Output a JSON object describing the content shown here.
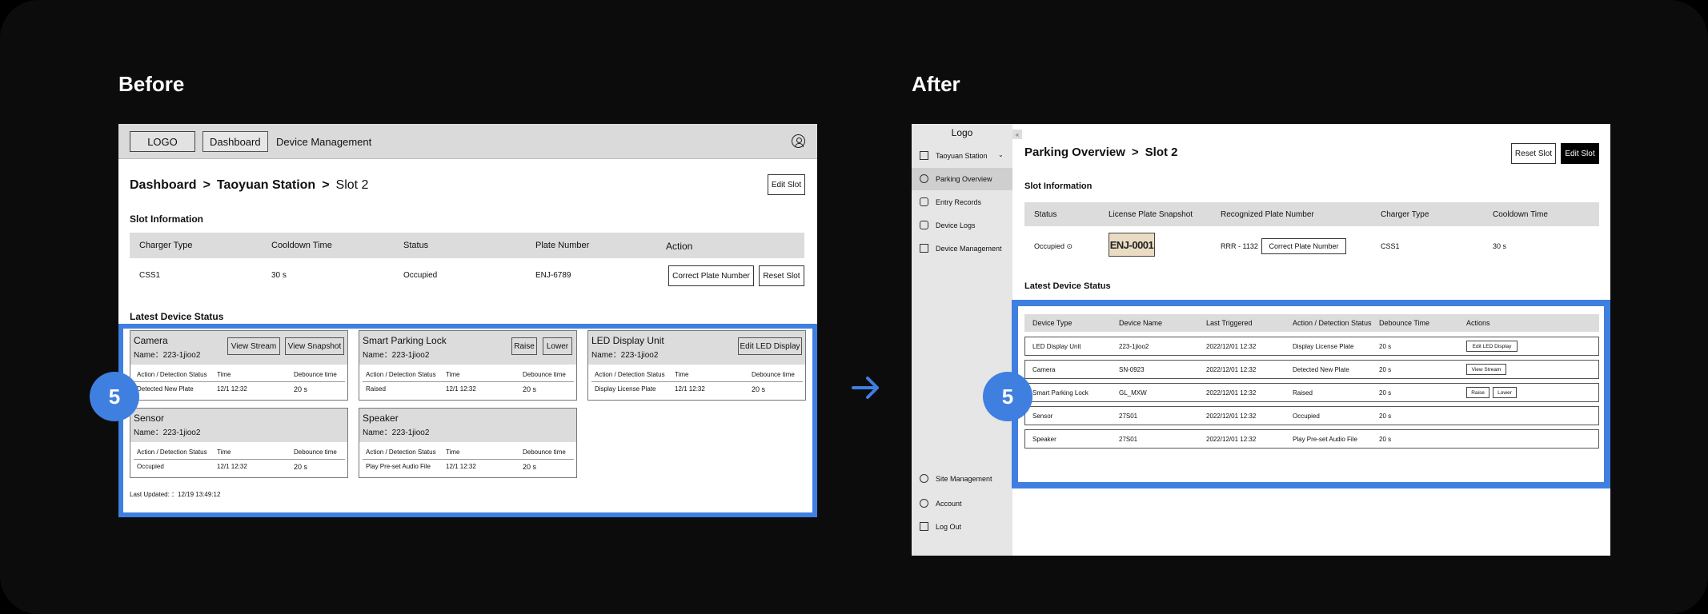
{
  "labels": {
    "before": "Before",
    "after": "After",
    "step_number": "5"
  },
  "colors": {
    "accent": "#3f7fe0",
    "background": "#0c0c0c"
  },
  "before": {
    "topbar": {
      "logo": "LOGO",
      "nav_dashboard": "Dashboard",
      "nav_device_management": "Device Management",
      "user_icon": "user-icon"
    },
    "breadcrumb": {
      "part1": "Dashboard",
      "sep": ">",
      "part2": "Taoyuan Station",
      "part3": "Slot 2"
    },
    "edit_slot": "Edit Slot",
    "slot_info": {
      "title": "Slot Information",
      "headers": [
        "Charger Type",
        "Cooldown Time",
        "Status",
        "Plate Number",
        "Action"
      ],
      "values": [
        "CSS1",
        "30 s",
        "Occupied",
        "ENJ-6789"
      ],
      "correct_plate": "Correct Plate Number",
      "reset_slot": "Reset Slot"
    },
    "latest_title": "Latest Device Status",
    "cards": [
      {
        "title": "Camera",
        "name": "Name：223-1jioo2",
        "buttons": [
          "View Stream",
          "View Snapshot"
        ],
        "col_action": "Action / Detection Status",
        "col_time": "Time",
        "col_debounce": "Debounce time",
        "action": "Detected New Plate",
        "time": "12/1 12:32",
        "debounce": "20 s"
      },
      {
        "title": "Smart Parking Lock",
        "name": "Name：223-1jioo2",
        "buttons": [
          "Raise",
          "Lower"
        ],
        "col_action": "Action / Detection Status",
        "col_time": "Time",
        "col_debounce": "Debounce time",
        "action": "Raised",
        "time": "12/1 12:32",
        "debounce": "20 s"
      },
      {
        "title": "LED Display Unit",
        "name": "Name：223-1jioo2",
        "buttons": [
          "Edit LED Display"
        ],
        "col_action": "Action / Detection Status",
        "col_time": "Time",
        "col_debounce": "Debounce time",
        "action": "Display License Plate",
        "time": "12/1 12:32",
        "debounce": "20 s"
      },
      {
        "title": "Sensor",
        "name": "Name：223-1jioo2",
        "buttons": [],
        "col_action": "Action / Detection Status",
        "col_time": "Time",
        "col_debounce": "Debounce time",
        "action": "Occupied",
        "time": "12/1 12:32",
        "debounce": "20 s"
      },
      {
        "title": "Speaker",
        "name": "Name：223-1jioo2",
        "buttons": [],
        "col_action": "Action / Detection Status",
        "col_time": "Time",
        "col_debounce": "Debounce time",
        "action": "Play Pre-set Audio File",
        "time": "12/1 12:32",
        "debounce": "20 s"
      }
    ],
    "last_updated": "Last Updated: ：12/19 13:49:12"
  },
  "after": {
    "sidebar": {
      "logo": "Logo",
      "collapse": "«",
      "items": [
        {
          "label": "Taoyuan Station",
          "icon": "building-icon"
        },
        {
          "label": "Parking Overview",
          "icon": "parking-icon"
        },
        {
          "label": "Entry Records",
          "icon": "car-icon"
        },
        {
          "label": "Device Logs",
          "icon": "video-icon"
        },
        {
          "label": "Device Management",
          "icon": "network-icon"
        },
        {
          "label": "Site Management",
          "icon": "gear-icon"
        },
        {
          "label": "Account",
          "icon": "user-icon"
        },
        {
          "label": "Log Out",
          "icon": "logout-icon"
        }
      ]
    },
    "breadcrumb": {
      "part1": "Parking Overview",
      "sep": ">",
      "part2": "Slot 2"
    },
    "reset_slot": "Reset Slot",
    "edit_slot": "Edit Slot",
    "slot_info": {
      "title": "Slot Information",
      "headers": [
        "Status",
        "License Plate Snapshot",
        "Recognized Plate Number",
        "Charger Type",
        "Cooldown Time"
      ],
      "status": "Occupied ⊙",
      "plate_snapshot": "ENJ-0001",
      "plate_number": "RRR - 1132",
      "correct_plate": "Correct Plate Number",
      "charger": "CSS1",
      "cooldown": "30 s"
    },
    "latest_title": "Latest Device Status",
    "device_table": {
      "headers": [
        "Device Type",
        "Device Name",
        "Last Triggered",
        "Action / Detection Status",
        "Debounce Time",
        "Actions"
      ],
      "rows": [
        {
          "type": "LED Display Unit",
          "name": "223-1jioo2",
          "last": "2022/12/01 12:32",
          "status": "Display License Plate",
          "debounce": "20 s",
          "actions": [
            "Edit LED Display"
          ]
        },
        {
          "type": "Camera",
          "name": "SN-0923",
          "last": "2022/12/01 12:32",
          "status": "Detected New Plate",
          "debounce": "20 s",
          "actions": [
            "View Stream"
          ]
        },
        {
          "type": "Smart Parking Lock",
          "name": "GL_MXW",
          "last": "2022/12/01 12:32",
          "status": "Raised",
          "debounce": "20 s",
          "actions": [
            "Raise",
            "Lower"
          ]
        },
        {
          "type": "Sensor",
          "name": "27S01",
          "last": "2022/12/01 12:32",
          "status": "Occupied",
          "debounce": "20 s",
          "actions": []
        },
        {
          "type": "Speaker",
          "name": "27S01",
          "last": "2022/12/01 12:32",
          "status": "Play Pre-set Audio File",
          "debounce": "20 s",
          "actions": []
        }
      ]
    }
  }
}
